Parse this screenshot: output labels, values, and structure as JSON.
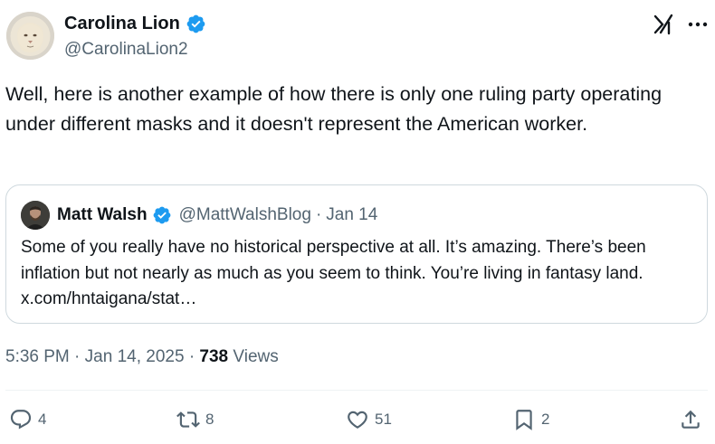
{
  "author": {
    "name": "Carolina Lion",
    "handle": "@CarolinaLion2"
  },
  "tweet": {
    "text": "Well, here is another example of how there is only one ruling party operating under different masks and it doesn't represent the American worker."
  },
  "quote": {
    "name": "Matt Walsh",
    "handle": "@MattWalshBlog",
    "separator": "·",
    "date": "Jan 14",
    "text": "Some of you really have no historical perspective at all. It’s amazing. There’s been inflation but not nearly as much as you seem to think. You’re living in fantasy land. x.com/hntaigana/stat…"
  },
  "meta": {
    "time": "5:36 PM",
    "separator": "·",
    "date": "Jan 14, 2025",
    "separator2": "·",
    "views_count": "738",
    "views_label": "Views"
  },
  "actions": {
    "replies": "4",
    "reposts": "8",
    "likes": "51",
    "bookmarks": "2"
  },
  "colors": {
    "verified": "#1d9bf0",
    "secondary_text": "#536471",
    "primary_text": "#0f1419",
    "border": "#cfd9de"
  },
  "icons": {
    "verified": "verified-badge-icon",
    "grok": "grok-icon",
    "more": "more-options-icon",
    "reply": "reply-icon",
    "repost": "repost-icon",
    "like": "heart-icon",
    "bookmark": "bookmark-icon",
    "share": "share-icon"
  }
}
